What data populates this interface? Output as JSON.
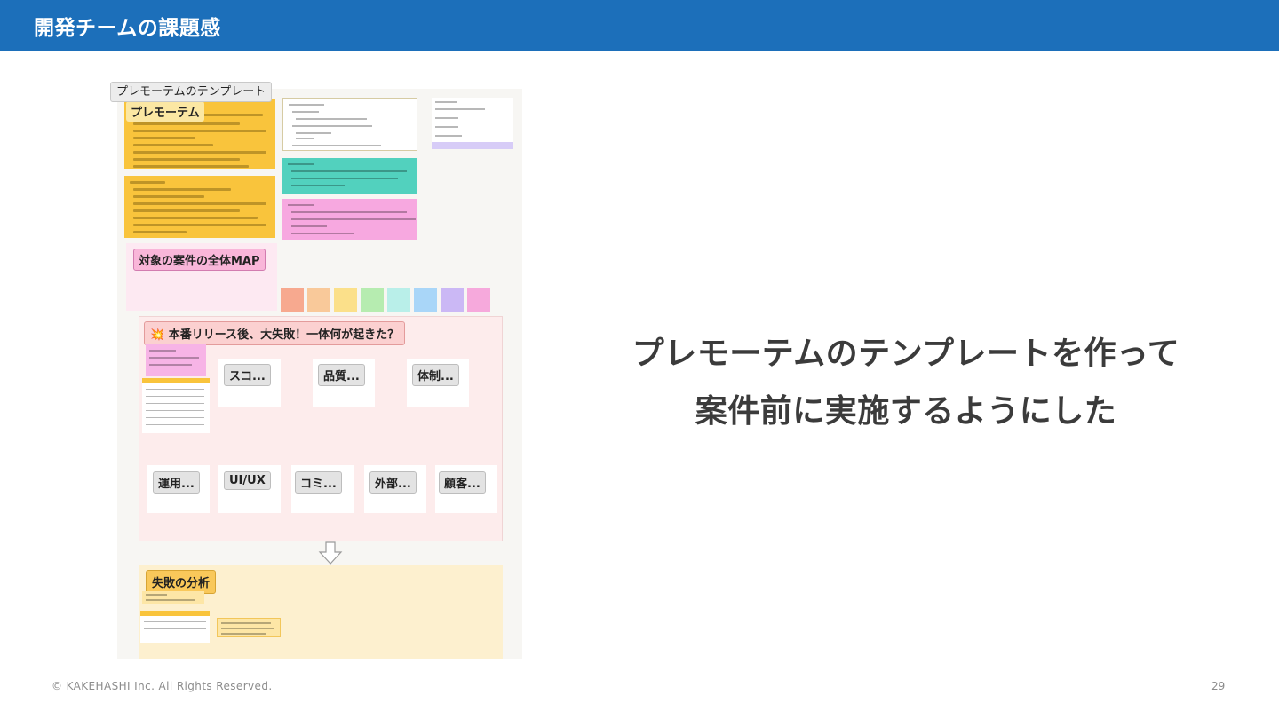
{
  "header": {
    "title": "開発チームの課題感"
  },
  "board": {
    "template_tag": "プレモーテムのテンプレート",
    "premortem_title": "プレモーテム",
    "map_title": "対象の案件の全体MAP",
    "release_title": "💥 本番リリース後、大失敗！一体何が起きた？",
    "categories_top": [
      "スコ...",
      "品質...",
      "体制..."
    ],
    "categories_bottom": [
      "運用...",
      "UI/UX",
      "コミ...",
      "外部...",
      "顧客..."
    ],
    "analysis_title": "失敗の分析",
    "sticky_colors": [
      "#f7a98f",
      "#f9c99a",
      "#fbe08a",
      "#b6ecb0",
      "#b9efe9",
      "#a9d6f8",
      "#cbb8f5",
      "#f6a9dc"
    ]
  },
  "main": {
    "line1": "プレモーテムのテンプレートを作って",
    "line2": "案件前に実施するようにした"
  },
  "footer": {
    "copyright": "© KAKEHASHI Inc. All Rights Reserved.",
    "page_number": "29"
  },
  "colors": {
    "header_bg": "#1c6fba",
    "text": "#3b3b3b",
    "footer": "#8c8c8c"
  }
}
